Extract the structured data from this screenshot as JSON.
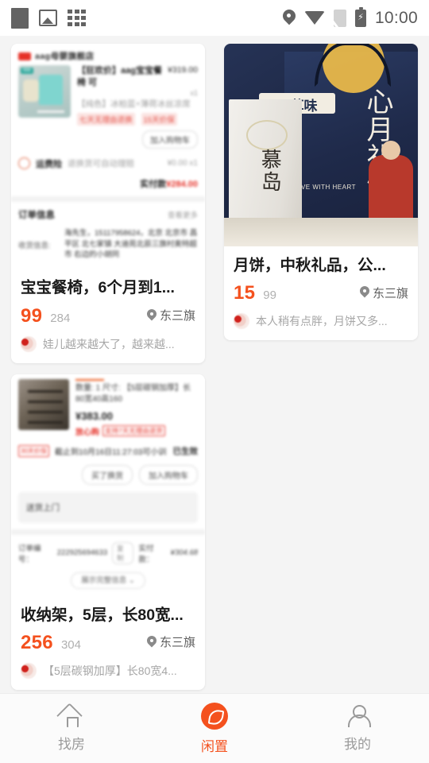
{
  "statusbar": {
    "time": "10:00",
    "left_icons": [
      "square-icon",
      "image-icon",
      "grid-icon"
    ],
    "right_icons": [
      "location-pin-icon",
      "wifi-icon",
      "sim-card-icon",
      "battery-charging-icon"
    ]
  },
  "theme": {
    "accent": "#f4511e",
    "price_color": "#f4511e",
    "old_price_color": "#b0b0b0",
    "desc_color": "#a6a6a6",
    "page_bg": "#f4f4f4",
    "card_bg": "#ffffff",
    "red": "#e5332a"
  },
  "feed": {
    "cards": [
      {
        "id": "baby-highchair",
        "media_type": "order-screenshot",
        "order_screenshot": {
          "shop_name": "aag母婴旗舰店",
          "product_title": "【狂欢价】aag宝宝餐椅 可",
          "product_sub": "【纯色】冰柏蓝+薄荷冰丝凉席",
          "product_price": "¥319.00",
          "product_qty": "x1",
          "thumb_tag": "666",
          "service_tags": [
            "七天无理由退换",
            "15天价保"
          ],
          "cart_button": "加入购物车",
          "freight_label": "运费险",
          "freight_value": "退换货可自动理赔",
          "freight_price": "¥0.00 x1",
          "total_label": "实付款",
          "total_value": "¥284.00",
          "order_info_title": "订单信息",
          "order_info_more": "查看更多",
          "address_label": "收货信息:",
          "address_value": "海先生，15117958624，北京 北京市 昌平区 北七家镇 大迪苑北辰三旗村奥特超市 右边的小胡同"
        },
        "title": "宝宝餐椅，6个月到1...",
        "price": "99",
        "original_price": "284",
        "location": "东三旗",
        "description": "娃儿越来越大了，越来越..."
      },
      {
        "id": "mooncake",
        "media_type": "photo",
        "photo": {
          "alt": "mooncake-gift-box-photo",
          "brand_logo_text": "百草味",
          "bag_text": "心月礼饼",
          "bag_en": "EXPRESS LOVE WITH HEART",
          "box_text": "慕岛"
        },
        "title": "月饼，中秋礼品，公...",
        "price": "15",
        "original_price": "99",
        "location": "东三旗",
        "description": "本人稍有点胖，月饼又多..."
      },
      {
        "id": "storage-rack",
        "media_type": "order-screenshot-2",
        "order_screenshot": {
          "product_title": "数量: 1  尺寸: 【5层碳钢加厚】长80宽40高160",
          "product_price": "¥383.00",
          "heart_label": "放心购",
          "heart_tag": "支持7天无理由退货",
          "deadline_badge": "30天价保",
          "deadline_text": "截止到10月16日11:27:03可小训",
          "status": "已生效",
          "buttons": [
            "买了换货",
            "加入购物车"
          ],
          "delivery_note": "送货上门",
          "order_no_label": "订单编号：",
          "order_no_value": "222925694633",
          "copy_label": "复制",
          "paid_label": "实付款：",
          "paid_value": "¥304.68",
          "expand_label": "展示完整信息 ⌄"
        },
        "title": "收纳架，5层，长80宽...",
        "price": "256",
        "original_price": "304",
        "location": "东三旗",
        "description": "【5层碳钢加厚】长80宽4..."
      }
    ]
  },
  "tabbar": {
    "items": [
      {
        "id": "find-house",
        "label": "找房",
        "icon": "home-icon",
        "active": false
      },
      {
        "id": "idle",
        "label": "闲置",
        "icon": "leaf-icon",
        "active": true
      },
      {
        "id": "mine",
        "label": "我的",
        "icon": "user-icon",
        "active": false
      }
    ]
  }
}
